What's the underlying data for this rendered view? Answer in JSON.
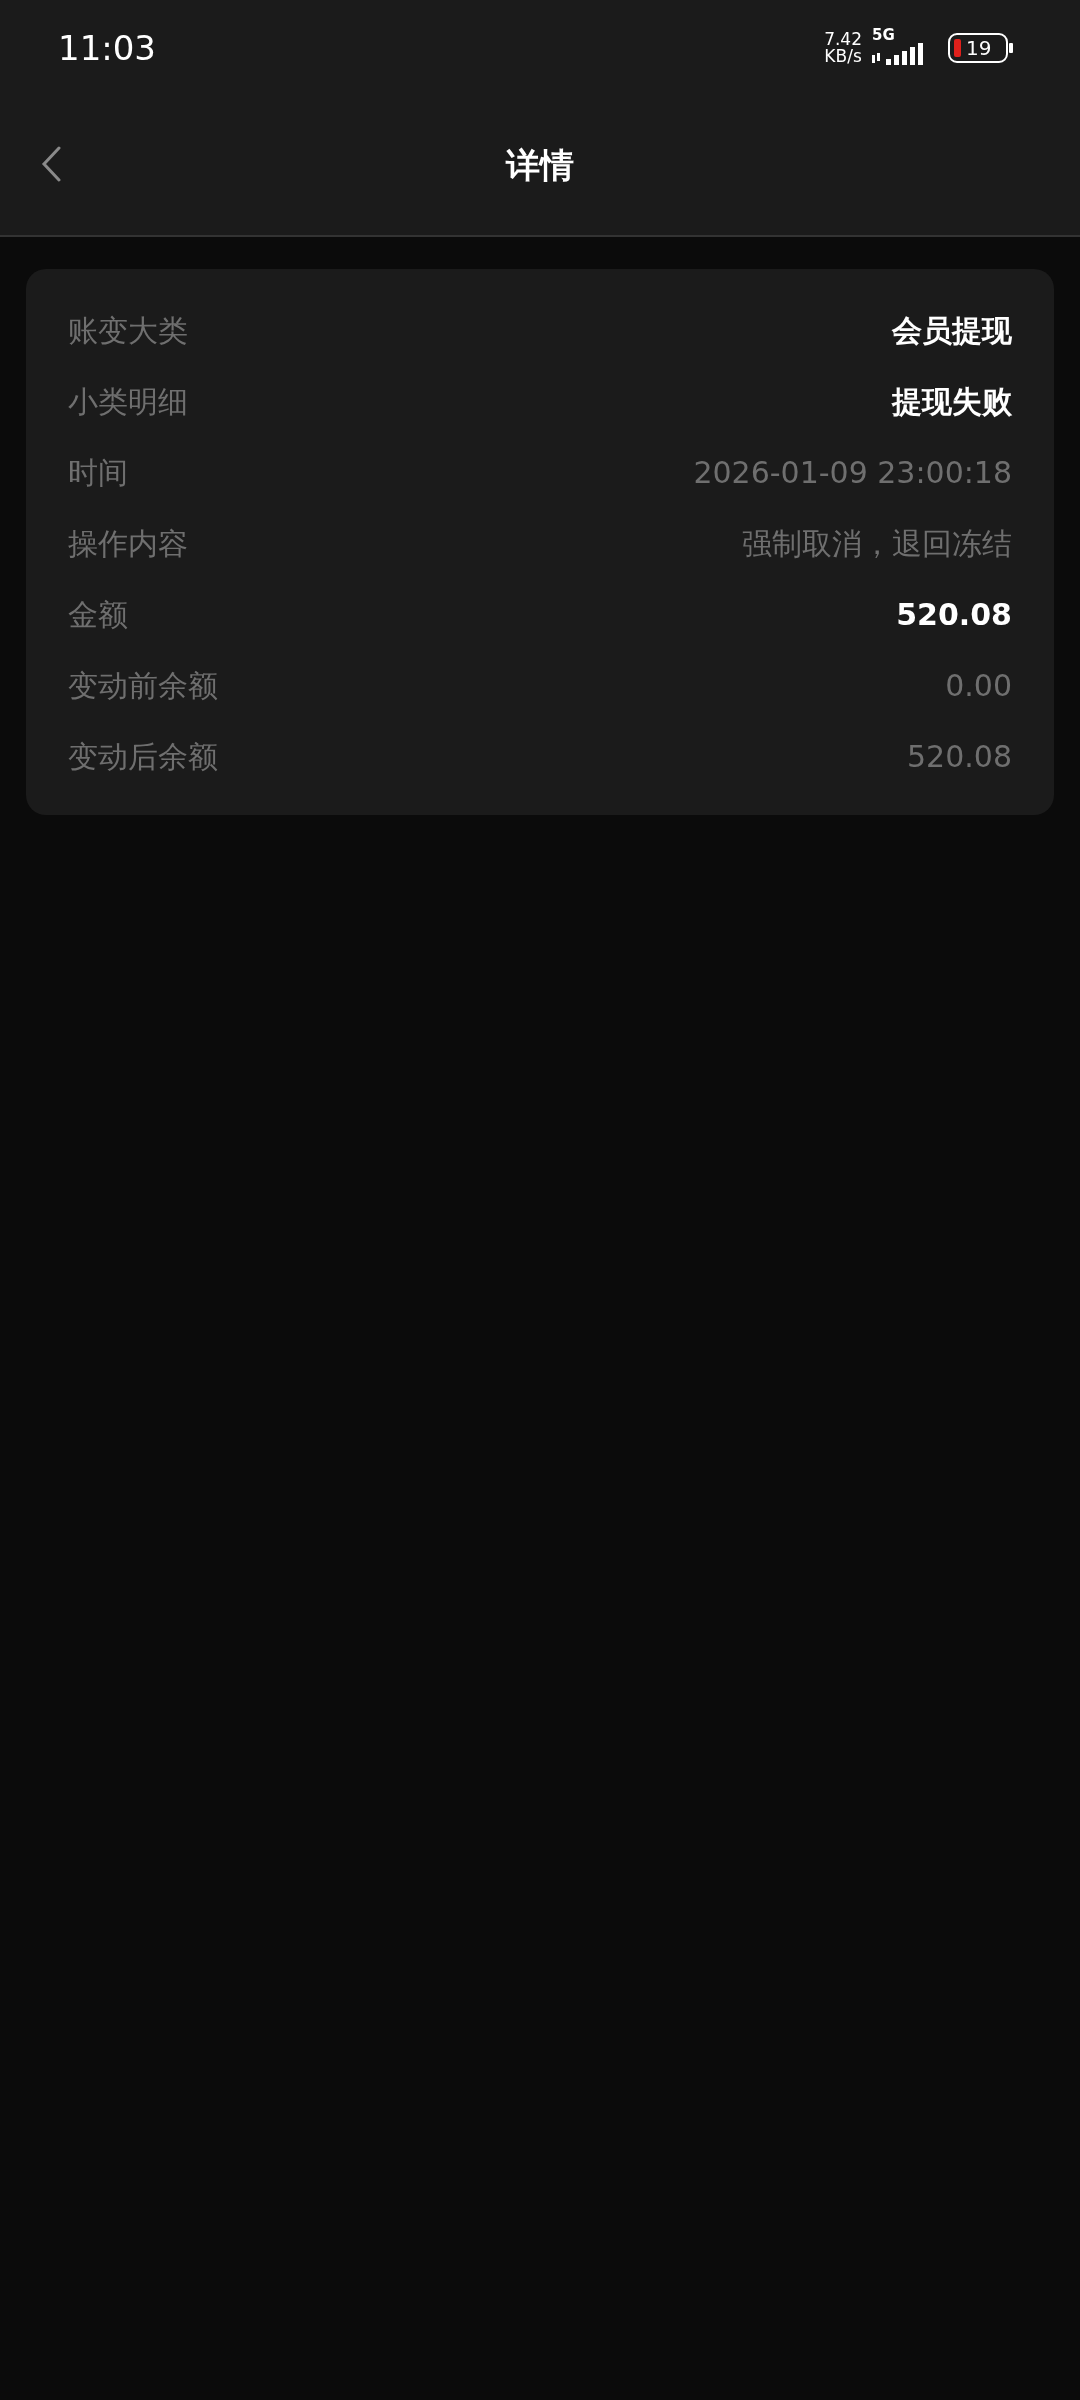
{
  "status_bar": {
    "time": "11:03",
    "speed": "7.42",
    "speed_unit": "KB/s",
    "network": "5G",
    "battery": "19"
  },
  "header": {
    "title": "详情"
  },
  "details": [
    {
      "label": "账变大类",
      "value": "会员提现",
      "emphasis": true
    },
    {
      "label": "小类明细",
      "value": "提现失败",
      "emphasis": true
    },
    {
      "label": "时间",
      "value": "2026-01-09 23:00:18",
      "emphasis": false
    },
    {
      "label": "操作内容",
      "value": "强制取消，退回冻结",
      "emphasis": false
    },
    {
      "label": "金额",
      "value": "520.08",
      "emphasis": true
    },
    {
      "label": "变动前余额",
      "value": "0.00",
      "emphasis": false
    },
    {
      "label": "变动后余额",
      "value": "520.08",
      "emphasis": false
    }
  ]
}
